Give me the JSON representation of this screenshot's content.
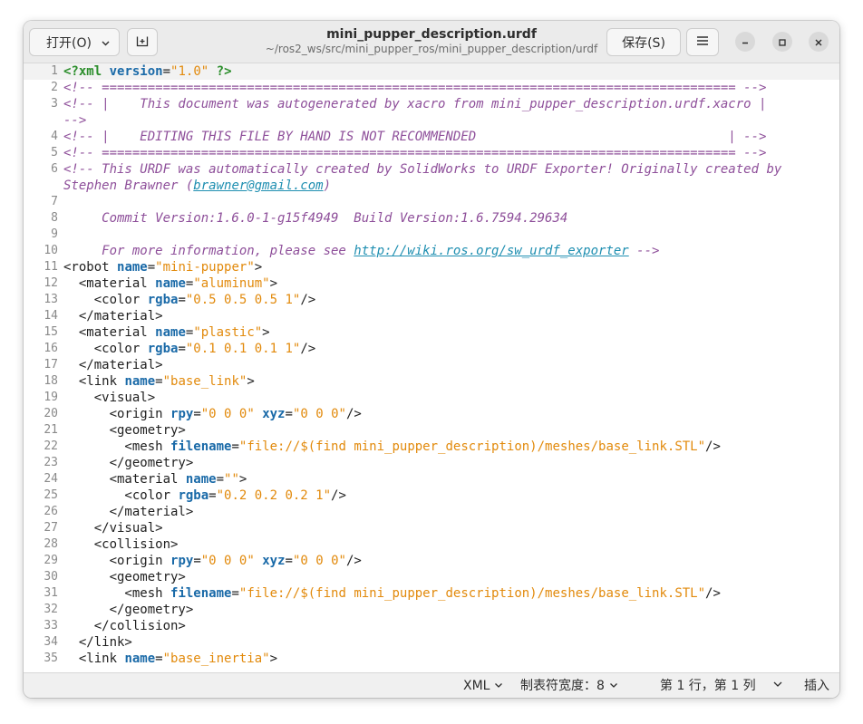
{
  "header": {
    "open_label": "打开(O)",
    "title": "mini_pupper_description.urdf",
    "subtitle": "~/ros2_ws/src/mini_pupper_ros/mini_pupper_description/urdf",
    "save_label": "保存(S)"
  },
  "editor": {
    "lines": [
      {
        "n": "1",
        "cur": true,
        "t": [
          [
            "pi",
            "<?"
          ],
          [
            "pi",
            "xml"
          ],
          [
            "",
            "&#32;"
          ],
          [
            "attr",
            "version"
          ],
          [
            "eq",
            "="
          ],
          [
            "val",
            "\"1.0\""
          ],
          [
            "",
            "&#32;"
          ],
          [
            "pi",
            "?>"
          ]
        ]
      },
      {
        "n": "2",
        "t": [
          [
            "cm",
            "<!-- =================================================================================== -->"
          ]
        ]
      },
      {
        "n": "3",
        "t": [
          [
            "cm",
            "<!-- |    This document was autogenerated by xacro from mini_pupper_description.urdf.xacro |"
          ]
        ]
      },
      {
        "n": "",
        "t": [
          [
            "cm",
            "-->"
          ]
        ]
      },
      {
        "n": "4",
        "t": [
          [
            "cm",
            "<!-- |    EDITING THIS FILE BY HAND IS NOT RECOMMENDED                                 | -->"
          ]
        ]
      },
      {
        "n": "5",
        "t": [
          [
            "cm",
            "<!-- =================================================================================== -->"
          ]
        ]
      },
      {
        "n": "6",
        "t": [
          [
            "cm",
            "<!-- This URDF was automatically created by SolidWorks to URDF Exporter! Originally created by"
          ]
        ]
      },
      {
        "n": "",
        "t": [
          [
            "cm",
            "Stephen Brawner ("
          ],
          [
            "link",
            "brawner@gmail.com"
          ],
          [
            "cm",
            ")"
          ]
        ]
      },
      {
        "n": "7",
        "t": [
          [
            "",
            ""
          ]
        ]
      },
      {
        "n": "8",
        "t": [
          [
            "cm",
            "     Commit Version:1.6.0-1-g15f4949  Build Version:1.6.7594.29634"
          ]
        ]
      },
      {
        "n": "9",
        "t": [
          [
            "",
            ""
          ]
        ]
      },
      {
        "n": "10",
        "t": [
          [
            "cm",
            "     For more information, please see "
          ],
          [
            "link",
            "http://wiki.ros.org/sw_urdf_exporter"
          ],
          [
            "cm",
            " -->"
          ]
        ]
      },
      {
        "n": "11",
        "t": [
          [
            "tag",
            "<robot "
          ],
          [
            "attr",
            "name"
          ],
          [
            "eq",
            "="
          ],
          [
            "val",
            "\"mini-pupper\""
          ],
          [
            "tag",
            ">"
          ]
        ]
      },
      {
        "n": "12",
        "t": [
          [
            "tag",
            "  <material "
          ],
          [
            "attr",
            "name"
          ],
          [
            "eq",
            "="
          ],
          [
            "val",
            "\"aluminum\""
          ],
          [
            "tag",
            ">"
          ]
        ]
      },
      {
        "n": "13",
        "t": [
          [
            "tag",
            "    <color "
          ],
          [
            "attr",
            "rgba"
          ],
          [
            "eq",
            "="
          ],
          [
            "val",
            "\"0.5 0.5 0.5 1\""
          ],
          [
            "tag",
            "/>"
          ]
        ]
      },
      {
        "n": "14",
        "t": [
          [
            "tag",
            "  </material>"
          ]
        ]
      },
      {
        "n": "15",
        "t": [
          [
            "tag",
            "  <material "
          ],
          [
            "attr",
            "name"
          ],
          [
            "eq",
            "="
          ],
          [
            "val",
            "\"plastic\""
          ],
          [
            "tag",
            ">"
          ]
        ]
      },
      {
        "n": "16",
        "t": [
          [
            "tag",
            "    <color "
          ],
          [
            "attr",
            "rgba"
          ],
          [
            "eq",
            "="
          ],
          [
            "val",
            "\"0.1 0.1 0.1 1\""
          ],
          [
            "tag",
            "/>"
          ]
        ]
      },
      {
        "n": "17",
        "t": [
          [
            "tag",
            "  </material>"
          ]
        ]
      },
      {
        "n": "18",
        "t": [
          [
            "tag",
            "  <link "
          ],
          [
            "attr",
            "name"
          ],
          [
            "eq",
            "="
          ],
          [
            "val",
            "\"base_link\""
          ],
          [
            "tag",
            ">"
          ]
        ]
      },
      {
        "n": "19",
        "t": [
          [
            "tag",
            "    <visual>"
          ]
        ]
      },
      {
        "n": "20",
        "t": [
          [
            "tag",
            "      <origin "
          ],
          [
            "attr",
            "rpy"
          ],
          [
            "eq",
            "="
          ],
          [
            "val",
            "\"0 0 0\""
          ],
          [
            "tag",
            " "
          ],
          [
            "attr",
            "xyz"
          ],
          [
            "eq",
            "="
          ],
          [
            "val",
            "\"0 0 0\""
          ],
          [
            "tag",
            "/>"
          ]
        ]
      },
      {
        "n": "21",
        "t": [
          [
            "tag",
            "      <geometry>"
          ]
        ]
      },
      {
        "n": "22",
        "t": [
          [
            "tag",
            "        <mesh "
          ],
          [
            "attr",
            "filename"
          ],
          [
            "eq",
            "="
          ],
          [
            "val",
            "\"file://$(find mini_pupper_description)/meshes/base_link.STL\""
          ],
          [
            "tag",
            "/>"
          ]
        ]
      },
      {
        "n": "23",
        "t": [
          [
            "tag",
            "      </geometry>"
          ]
        ]
      },
      {
        "n": "24",
        "t": [
          [
            "tag",
            "      <material "
          ],
          [
            "attr",
            "name"
          ],
          [
            "eq",
            "="
          ],
          [
            "val",
            "\"\""
          ],
          [
            "tag",
            ">"
          ]
        ]
      },
      {
        "n": "25",
        "t": [
          [
            "tag",
            "        <color "
          ],
          [
            "attr",
            "rgba"
          ],
          [
            "eq",
            "="
          ],
          [
            "val",
            "\"0.2 0.2 0.2 1\""
          ],
          [
            "tag",
            "/>"
          ]
        ]
      },
      {
        "n": "26",
        "t": [
          [
            "tag",
            "      </material>"
          ]
        ]
      },
      {
        "n": "27",
        "t": [
          [
            "tag",
            "    </visual>"
          ]
        ]
      },
      {
        "n": "28",
        "t": [
          [
            "tag",
            "    <collision>"
          ]
        ]
      },
      {
        "n": "29",
        "t": [
          [
            "tag",
            "      <origin "
          ],
          [
            "attr",
            "rpy"
          ],
          [
            "eq",
            "="
          ],
          [
            "val",
            "\"0 0 0\""
          ],
          [
            "tag",
            " "
          ],
          [
            "attr",
            "xyz"
          ],
          [
            "eq",
            "="
          ],
          [
            "val",
            "\"0 0 0\""
          ],
          [
            "tag",
            "/>"
          ]
        ]
      },
      {
        "n": "30",
        "t": [
          [
            "tag",
            "      <geometry>"
          ]
        ]
      },
      {
        "n": "31",
        "t": [
          [
            "tag",
            "        <mesh "
          ],
          [
            "attr",
            "filename"
          ],
          [
            "eq",
            "="
          ],
          [
            "val",
            "\"file://$(find mini_pupper_description)/meshes/base_link.STL\""
          ],
          [
            "tag",
            "/>"
          ]
        ]
      },
      {
        "n": "32",
        "t": [
          [
            "tag",
            "      </geometry>"
          ]
        ]
      },
      {
        "n": "33",
        "t": [
          [
            "tag",
            "    </collision>"
          ]
        ]
      },
      {
        "n": "34",
        "t": [
          [
            "tag",
            "  </link>"
          ]
        ]
      },
      {
        "n": "35",
        "t": [
          [
            "tag",
            "  <link "
          ],
          [
            "attr",
            "name"
          ],
          [
            "eq",
            "="
          ],
          [
            "val",
            "\"base_inertia\""
          ],
          [
            "tag",
            ">"
          ]
        ]
      }
    ]
  },
  "statusbar": {
    "language": "XML",
    "tab_width": "制表符宽度：8",
    "position": "第 1 行，第 1 列",
    "insert_mode": "插入"
  }
}
